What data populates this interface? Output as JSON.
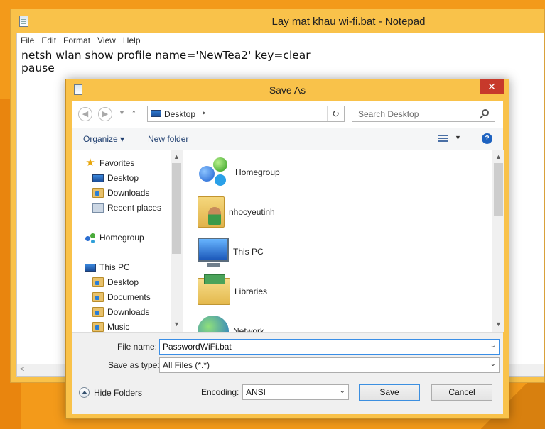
{
  "notepad": {
    "title": "Lay mat khau wi-fi.bat - Notepad",
    "menu": [
      "File",
      "Edit",
      "Format",
      "View",
      "Help"
    ],
    "content": "netsh wlan show profile name='NewTea2' key=clear\npause"
  },
  "dialog": {
    "title": "Save As",
    "close_symbol": "✕",
    "address": {
      "location": "Desktop",
      "search_placeholder": "Search Desktop"
    },
    "toolbar": {
      "organize": "Organize ▾",
      "new_folder": "New folder",
      "help_symbol": "?"
    },
    "nav": {
      "favorites": "Favorites",
      "fav_items": [
        "Desktop",
        "Downloads",
        "Recent places"
      ],
      "homegroup": "Homegroup",
      "this_pc": "This PC",
      "pc_items": [
        "Desktop",
        "Documents",
        "Downloads",
        "Music"
      ]
    },
    "files": [
      "Homegroup",
      "nhocyeutinh",
      "This PC",
      "Libraries",
      "Network"
    ],
    "form": {
      "file_name_label": "File name:",
      "file_name_value": "PasswordWiFi.bat",
      "save_type_label": "Save as type:",
      "save_type_value": "All Files  (*.*)",
      "hide_folders": "Hide Folders",
      "encoding_label": "Encoding:",
      "encoding_value": "ANSI",
      "save": "Save",
      "cancel": "Cancel"
    }
  },
  "colors": {
    "window_frame": "#f9c24a",
    "desktop": "#f39a1a",
    "close_button": "#c7392b",
    "focus_border": "#3a8ee6"
  }
}
